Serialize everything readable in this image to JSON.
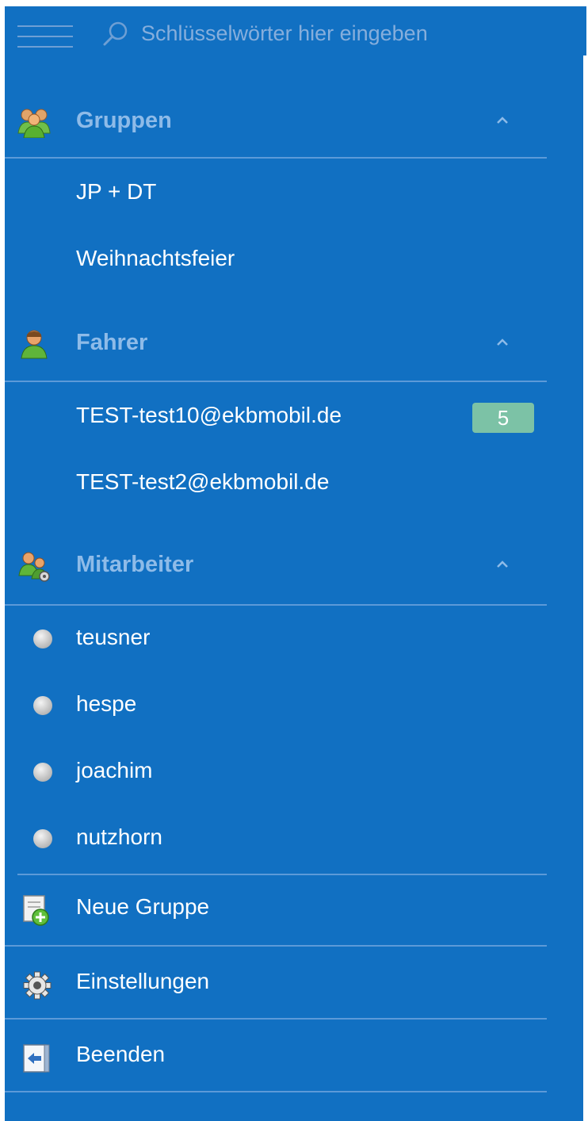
{
  "search": {
    "placeholder": "Schlüsselwörter hier eingeben"
  },
  "sections": {
    "gruppen": {
      "title": "Gruppen",
      "items": [
        {
          "label": "JP + DT"
        },
        {
          "label": "Weihnachtsfeier"
        }
      ]
    },
    "fahrer": {
      "title": "Fahrer",
      "items": [
        {
          "label": "TEST-test10@ekbmobil.de",
          "badge": "5"
        },
        {
          "label": "TEST-test2@ekbmobil.de"
        }
      ]
    },
    "mitarbeiter": {
      "title": "Mitarbeiter",
      "items": [
        {
          "label": "teusner"
        },
        {
          "label": "hespe"
        },
        {
          "label": "joachim"
        },
        {
          "label": "nutzhorn"
        }
      ]
    }
  },
  "actions": {
    "new_group": "Neue Gruppe",
    "settings": "Einstellungen",
    "exit": "Beenden"
  },
  "colors": {
    "panel_background": "#1170c2",
    "section_title": "#8ebbe8",
    "badge": "#7cc2a6",
    "text": "#ffffff"
  },
  "icons": {
    "menu": "hamburger-icon",
    "search": "search-icon",
    "gruppen": "group-icon",
    "fahrer": "driver-icon",
    "mitarbeiter": "employee-settings-icon",
    "collapse": "chevron-up-icon",
    "status": "status-dot",
    "new_group": "new-group-icon",
    "settings": "gear-icon",
    "exit": "exit-icon"
  }
}
